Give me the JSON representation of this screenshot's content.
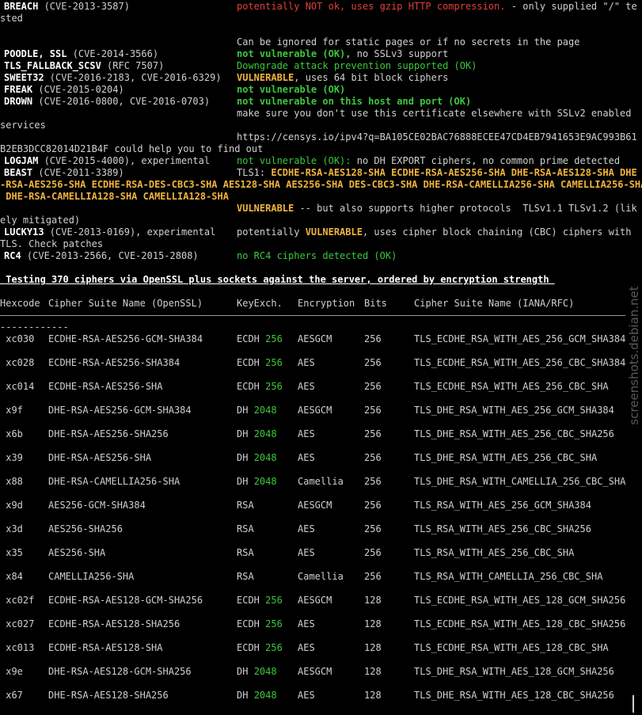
{
  "vuln_rows": [
    {
      "name": "BREACH",
      "cve": " (CVE-2013-3587)",
      "msg": [
        {
          "t": "potentially NOT ok, uses gzip HTTP compression.",
          "c": "red"
        },
        {
          "t": " - only supplied \"/\" te",
          "c": ""
        }
      ]
    },
    {
      "cont": "sted"
    },
    {
      "blank": true
    },
    {
      "msg_only": [
        {
          "t": "Can be ignored for static pages or if no secrets in the page",
          "c": ""
        }
      ]
    },
    {
      "name": "POODLE, SSL",
      "cve": " (CVE-2014-3566)",
      "msg": [
        {
          "t": "not vulnerable (OK)",
          "c": "green b"
        },
        {
          "t": ", no SSLv3 support",
          "c": ""
        }
      ]
    },
    {
      "name": "TLS_FALLBACK_SCSV",
      "cve": " (RFC 7507)",
      "msg": [
        {
          "t": "Downgrade attack prevention supported (OK)",
          "c": "green"
        }
      ]
    },
    {
      "name": "SWEET32",
      "cve": " (CVE-2016-2183, CVE-2016-6329)",
      "msg": [
        {
          "t": "VULNERABLE",
          "c": "yellow b"
        },
        {
          "t": ", uses 64 bit block ciphers",
          "c": ""
        }
      ]
    },
    {
      "name": "FREAK",
      "cve": " (CVE-2015-0204)",
      "msg": [
        {
          "t": "not vulnerable (OK)",
          "c": "green b"
        }
      ]
    },
    {
      "name": "DROWN",
      "cve": " (CVE-2016-0800, CVE-2016-0703)",
      "msg": [
        {
          "t": "not vulnerable on this host and port (OK)",
          "c": "green b"
        }
      ]
    },
    {
      "msg_only": [
        {
          "t": "make sure you don't use this certificate elsewhere with SSLv2 enabled",
          "c": ""
        }
      ]
    },
    {
      "cont": "services"
    },
    {
      "msg_only": [
        {
          "t": "https://censys.io/ipv4?q=BA105CE02BAC76888ECEE47CD4EB7941653E9AC993B61",
          "c": ""
        }
      ]
    },
    {
      "cont": "B2EB3DCC82014D21B4F could help you to find out"
    },
    {
      "name": "LOGJAM",
      "cve": " (CVE-2015-4000), experimental",
      "msg": [
        {
          "t": "not vulnerable (OK):",
          "c": "green"
        },
        {
          "t": " no DH EXPORT ciphers, no common prime detected",
          "c": ""
        }
      ]
    },
    {
      "name": "BEAST",
      "cve": " (CVE-2011-3389)",
      "msg": [
        {
          "t": "TLS1: ",
          "c": ""
        },
        {
          "t": "ECDHE-RSA-AES128-SHA ECDHE-RSA-AES256-SHA DHE-RSA-AES128-SHA DHE",
          "c": "yellow b"
        }
      ]
    },
    {
      "cont_colored": [
        {
          "t": "-RSA-AES256-SHA ECDHE-RSA-DES-CBC3-SHA AES128-SHA AES256-SHA DES-CBC3-SHA DHE-RSA-CAMELLIA256-SHA CAMELLIA256-SHA",
          "c": "yellow b"
        }
      ]
    },
    {
      "cont_colored": [
        {
          "t": " DHE-RSA-CAMELLIA128-SHA CAMELLIA128-SHA",
          "c": "yellow b"
        }
      ]
    },
    {
      "msg_only": [
        {
          "t": "VULNERABLE",
          "c": "yellow b"
        },
        {
          "t": " -- but also supports higher protocols  TLSv1.1 TLSv1.2 (lik",
          "c": ""
        }
      ]
    },
    {
      "cont": "ely mitigated)"
    },
    {
      "name": "LUCKY13",
      "cve": " (CVE-2013-0169), experimental",
      "msg": [
        {
          "t": "potentially ",
          "c": ""
        },
        {
          "t": "VULNERABLE",
          "c": "yellow b"
        },
        {
          "t": ", uses cipher block chaining (CBC) ciphers with",
          "c": ""
        }
      ]
    },
    {
      "cont": "TLS. Check patches"
    },
    {
      "name": "RC4",
      "cve": " (CVE-2013-2566, CVE-2015-2808)",
      "msg": [
        {
          "t": "no RC4 ciphers detected (OK)",
          "c": "green"
        }
      ]
    }
  ],
  "section_heading": " Testing 370 ciphers via OpenSSL plus sockets against the server, ordered by encryption strength ",
  "table_headers": {
    "hex": "Hexcode",
    "name": "Cipher Suite Name (OpenSSL)",
    "kx": "KeyExch.",
    "enc": "Encryption",
    "bits": "Bits",
    "iana": "Cipher Suite Name (IANA/RFC)"
  },
  "rule_tail": "------------",
  "cipher_rows": [
    {
      "hex": "xc030",
      "name": "ECDHE-RSA-AES256-GCM-SHA384",
      "kx": "ECDH",
      "kxb": "256",
      "enc": "AESGCM",
      "bits": "256",
      "iana": "TLS_ECDHE_RSA_WITH_AES_256_GCM_SHA384"
    },
    {
      "hex": "xc028",
      "name": "ECDHE-RSA-AES256-SHA384",
      "kx": "ECDH",
      "kxb": "256",
      "enc": "AES",
      "bits": "256",
      "iana": "TLS_ECDHE_RSA_WITH_AES_256_CBC_SHA384"
    },
    {
      "hex": "xc014",
      "name": "ECDHE-RSA-AES256-SHA",
      "kx": "ECDH",
      "kxb": "256",
      "enc": "AES",
      "bits": "256",
      "iana": "TLS_ECDHE_RSA_WITH_AES_256_CBC_SHA"
    },
    {
      "hex": "x9f",
      "name": "DHE-RSA-AES256-GCM-SHA384",
      "kx": "DH",
      "kxb": "2048",
      "enc": "AESGCM",
      "bits": "256",
      "iana": "TLS_DHE_RSA_WITH_AES_256_GCM_SHA384"
    },
    {
      "hex": "x6b",
      "name": "DHE-RSA-AES256-SHA256",
      "kx": "DH",
      "kxb": "2048",
      "enc": "AES",
      "bits": "256",
      "iana": "TLS_DHE_RSA_WITH_AES_256_CBC_SHA256"
    },
    {
      "hex": "x39",
      "name": "DHE-RSA-AES256-SHA",
      "kx": "DH",
      "kxb": "2048",
      "enc": "AES",
      "bits": "256",
      "iana": "TLS_DHE_RSA_WITH_AES_256_CBC_SHA"
    },
    {
      "hex": "x88",
      "name": "DHE-RSA-CAMELLIA256-SHA",
      "kx": "DH",
      "kxb": "2048",
      "enc": "Camellia",
      "bits": "256",
      "iana": "TLS_DHE_RSA_WITH_CAMELLIA_256_CBC_SHA"
    },
    {
      "hex": "x9d",
      "name": "AES256-GCM-SHA384",
      "kx": "RSA",
      "kxb": "",
      "enc": "AESGCM",
      "bits": "256",
      "iana": "TLS_RSA_WITH_AES_256_GCM_SHA384"
    },
    {
      "hex": "x3d",
      "name": "AES256-SHA256",
      "kx": "RSA",
      "kxb": "",
      "enc": "AES",
      "bits": "256",
      "iana": "TLS_RSA_WITH_AES_256_CBC_SHA256"
    },
    {
      "hex": "x35",
      "name": "AES256-SHA",
      "kx": "RSA",
      "kxb": "",
      "enc": "AES",
      "bits": "256",
      "iana": "TLS_RSA_WITH_AES_256_CBC_SHA"
    },
    {
      "hex": "x84",
      "name": "CAMELLIA256-SHA",
      "kx": "RSA",
      "kxb": "",
      "enc": "Camellia",
      "bits": "256",
      "iana": "TLS_RSA_WITH_CAMELLIA_256_CBC_SHA"
    },
    {
      "hex": "xc02f",
      "name": "ECDHE-RSA-AES128-GCM-SHA256",
      "kx": "ECDH",
      "kxb": "256",
      "enc": "AESGCM",
      "bits": "128",
      "iana": "TLS_ECDHE_RSA_WITH_AES_128_GCM_SHA256"
    },
    {
      "hex": "xc027",
      "name": "ECDHE-RSA-AES128-SHA256",
      "kx": "ECDH",
      "kxb": "256",
      "enc": "AES",
      "bits": "128",
      "iana": "TLS_ECDHE_RSA_WITH_AES_128_CBC_SHA256"
    },
    {
      "hex": "xc013",
      "name": "ECDHE-RSA-AES128-SHA",
      "kx": "ECDH",
      "kxb": "256",
      "enc": "AES",
      "bits": "128",
      "iana": "TLS_ECDHE_RSA_WITH_AES_128_CBC_SHA"
    },
    {
      "hex": "x9e",
      "name": "DHE-RSA-AES128-GCM-SHA256",
      "kx": "DH",
      "kxb": "2048",
      "enc": "AESGCM",
      "bits": "128",
      "iana": "TLS_DHE_RSA_WITH_AES_128_GCM_SHA256"
    },
    {
      "hex": "x67",
      "name": "DHE-RSA-AES128-SHA256",
      "kx": "DH",
      "kxb": "2048",
      "enc": "AES",
      "bits": "128",
      "iana": "TLS_DHE_RSA_WITH_AES_128_CBC_SHA256"
    }
  ],
  "watermark": "screenshots.debian.net",
  "colors": {
    "background": "#000000",
    "text": "#d0d0d0",
    "red": "#e0403a",
    "green": "#3cc83c",
    "yellow": "#f0b43c"
  }
}
